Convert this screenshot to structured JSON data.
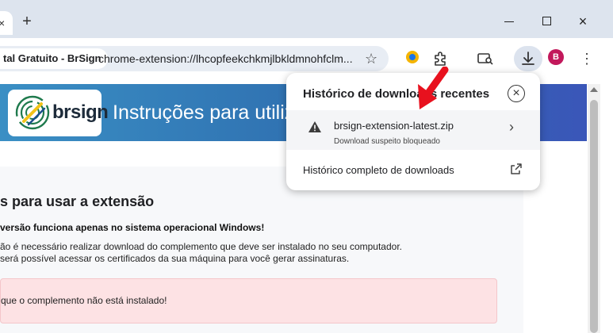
{
  "browser": {
    "tab_title": "tal Gratuito - BrSign",
    "new_tab": "+",
    "url": "chrome-extension://lhcopfeekchkmjlbkldmnohfclm...",
    "profile_initial": "B",
    "close_symbol": "×",
    "menu_symbol": "⋮",
    "star_symbol": "☆"
  },
  "page": {
    "logo_text": "brsign",
    "banner_title": "Instruções para utiliz",
    "heading": "s para usar a extensão",
    "warning_line": "versão funciona apenas no sistema operacional Windows!",
    "info_line1": "ão é necessário realizar download do complemento que deve ser instalado no seu computador.",
    "info_line2": "será possível acessar os certificados da sua máquina para você gerar assinaturas.",
    "alert_text": "que o complemento não está instalado!"
  },
  "downloads_popup": {
    "title": "Histórico de downloads recentes",
    "close_symbol": "×",
    "item": {
      "file_name": "brsign-extension-latest.zip",
      "status": "Download suspeito bloqueado",
      "chevron": "›"
    },
    "full_history": "Histórico completo de downloads"
  },
  "colors": {
    "warning": "#202124",
    "arrow": "#e8111e",
    "avatar": "#c2185b"
  }
}
